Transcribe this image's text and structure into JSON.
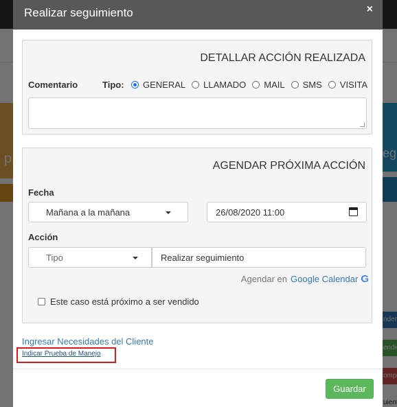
{
  "modal": {
    "title": "Realizar seguimiento",
    "close_glyph": "×"
  },
  "section_detail": {
    "heading": "DETALLAR ACCIÓN REALIZADA",
    "comment_label": "Comentario",
    "type_label": "Tipo:",
    "type_options": [
      {
        "label": "GENERAL",
        "selected": true
      },
      {
        "label": "LLAMADO",
        "selected": false
      },
      {
        "label": "MAIL",
        "selected": false
      },
      {
        "label": "SMS",
        "selected": false
      },
      {
        "label": "VISITA",
        "selected": false
      }
    ],
    "comment_value": ""
  },
  "section_schedule": {
    "heading": "AGENDAR PRÓXIMA ACCIÓN",
    "date_label": "Fecha",
    "date_preset": "Mañana a la mañana",
    "datetime_value": "26/08/2020  11:00",
    "action_label": "Acción",
    "action_type_placeholder": "Tipo",
    "action_value": "Realizar seguimiento",
    "calendar_prefix": "Agendar en",
    "calendar_link": "Google Calendar",
    "calendar_icon": "G",
    "near_sale_label": "Este caso está próximo a ser vendido",
    "near_sale_checked": false
  },
  "links": {
    "needs": "Ingresar Necesidades del Cliente",
    "test_drive": "Indicar Prueba de Manejo"
  },
  "footer": {
    "save_label": "Guardar"
  },
  "background": {
    "left_fragment": "p",
    "right_fragment": "egu",
    "side_buttons": [
      "nder",
      "endid",
      "omp",
      "uiente"
    ]
  },
  "colors": {
    "header": "#585858",
    "link": "#337ab7",
    "save": "#5cb85c",
    "highlight_box": "#d9181e",
    "radio_selected": "#1a73e8"
  }
}
